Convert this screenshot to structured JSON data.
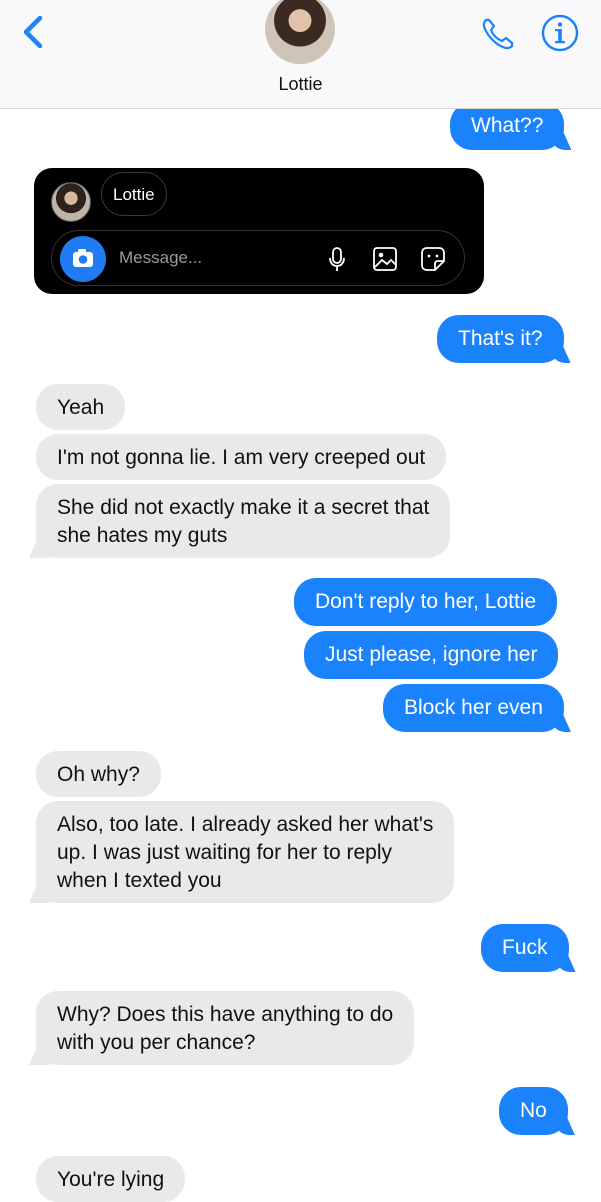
{
  "header": {
    "contact_name": "Lottie"
  },
  "overlay": {
    "name_chip": "Lottie",
    "input_placeholder": "Message..."
  },
  "messages": [
    {
      "dir": "out",
      "text": "What??"
    },
    {
      "dir": "out",
      "text": "That's it?"
    },
    {
      "dir": "in",
      "text": "Yeah"
    },
    {
      "dir": "in",
      "text": "I'm not gonna lie. I am very creeped out"
    },
    {
      "dir": "in",
      "text": "She did not exactly make it a secret that"
    },
    {
      "dir": "in",
      "text": "she hates my guts"
    },
    {
      "dir": "out",
      "text": "Don't reply to her, Lottie"
    },
    {
      "dir": "out",
      "text": "Just please, ignore her"
    },
    {
      "dir": "out",
      "text": "Block her even"
    },
    {
      "dir": "in",
      "text": "Oh why?"
    },
    {
      "dir": "in",
      "text": "Also, too late. I already asked her what's"
    },
    {
      "dir": "in",
      "text": "up. I was just waiting for her to reply"
    },
    {
      "dir": "in",
      "text": "when I texted you"
    },
    {
      "dir": "out",
      "text": "Fuck"
    },
    {
      "dir": "in",
      "text": "Why? Does this have anything to do"
    },
    {
      "dir": "in",
      "text": "with you per chance?"
    },
    {
      "dir": "out",
      "text": "No"
    },
    {
      "dir": "in",
      "text": "You're lying"
    }
  ],
  "colors": {
    "accent": "#1a82fb",
    "incoming_bubble": "#e9e9ec"
  }
}
